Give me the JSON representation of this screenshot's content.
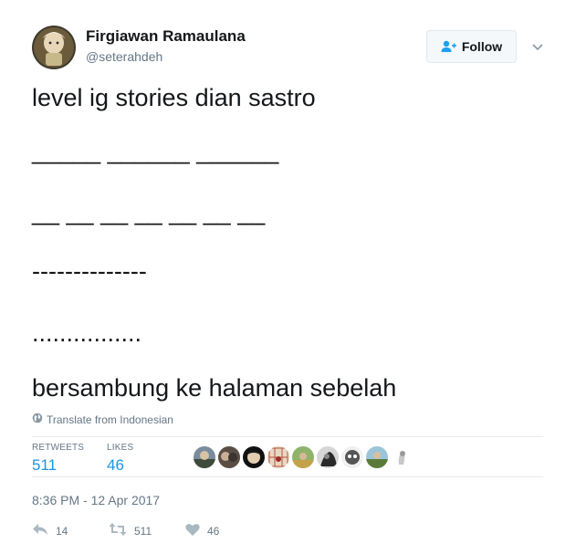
{
  "tweet": {
    "fullname": "Firgiawan Ramaulana",
    "username": "@seterahdeh",
    "follow_label": "Follow",
    "lines": [
      "level ig stories dian sastro",
      "_____ ______ ______",
      "__ __ __ __ __ __ __",
      "--------------",
      "................",
      "bersambung ke halaman sebelah"
    ],
    "translate_label": "Translate from Indonesian"
  },
  "stats": {
    "retweets_label": "RETWEETS",
    "retweets_count": "511",
    "likes_label": "LIKES",
    "likes_count": "46"
  },
  "timestamp": "8:36 PM - 12 Apr 2017",
  "actions": {
    "reply_count": "14",
    "retweet_count": "511",
    "like_count": "46"
  },
  "colors": {
    "link_blue": "#1b95e0",
    "secondary_gray": "#657786",
    "text": "#14171a"
  },
  "icons": [
    "follow-user-icon",
    "chevron-down-icon",
    "globe-icon",
    "reply-icon",
    "retweet-icon",
    "heart-icon"
  ]
}
